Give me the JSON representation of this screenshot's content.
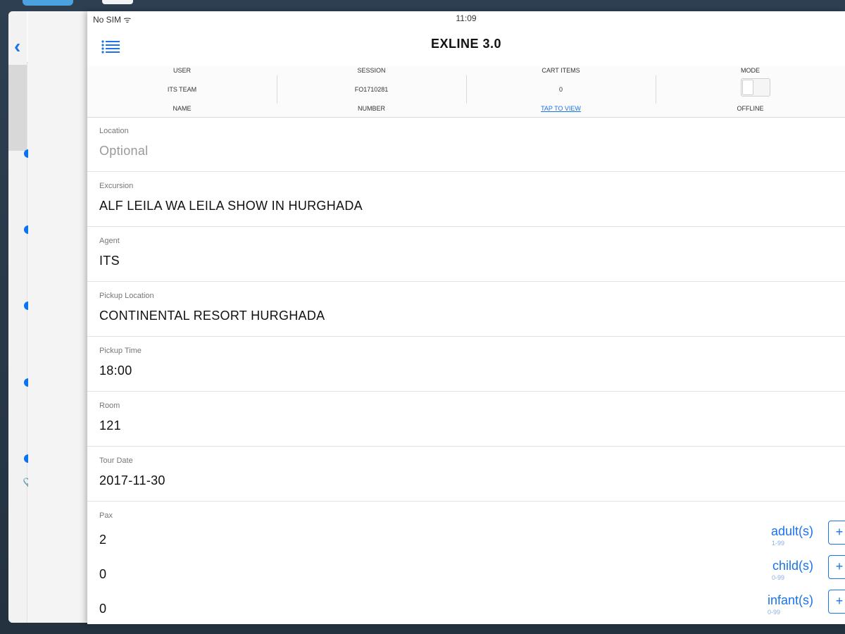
{
  "status_bar": {
    "carrier": "No SIM ᯤ",
    "time": "11:09"
  },
  "nav": {
    "title": "EXLINE 3.0"
  },
  "info": {
    "user": {
      "header": "USER",
      "value": "ITS TEAM",
      "footer": "NAME"
    },
    "session": {
      "header": "SESSION",
      "value": "FO1710281",
      "footer": "NUMBER"
    },
    "cart": {
      "header": "CART ITEMS",
      "value": "0",
      "footer": "TAP TO VIEW"
    },
    "mode": {
      "header": "MODE",
      "footer": "OFFLINE",
      "toggle_on": false
    }
  },
  "fields": [
    {
      "label": "Location",
      "value": "Optional",
      "placeholder": true
    },
    {
      "label": "Excursion",
      "value": "ALF LEILA WA LEILA SHOW IN HURGHADA"
    },
    {
      "label": "Agent",
      "value": "ITS"
    },
    {
      "label": "Pickup Location",
      "value": "CONTINENTAL RESORT HURGHADA"
    },
    {
      "label": "Pickup Time",
      "value": "18:00"
    },
    {
      "label": "Room",
      "value": "121"
    },
    {
      "label": "Tour Date",
      "value": "2017-11-30"
    }
  ],
  "pax": {
    "label": "Pax",
    "rows": [
      {
        "count": "2",
        "type": "adult(s)",
        "range": "1-99",
        "stepper": "+"
      },
      {
        "count": "0",
        "type": "child(s)",
        "range": "0-99",
        "stepper": "+"
      },
      {
        "count": "0",
        "type": "infant(s)",
        "range": "0-99",
        "stepper": "+"
      }
    ]
  },
  "icons": {
    "menu": "hamburger-list-icon",
    "back": "chevron-left-icon",
    "attachment": "paperclip-icon"
  },
  "colors": {
    "accent": "#1a73e8",
    "dot": "#0a74f0",
    "background": "#2b3a4a"
  }
}
